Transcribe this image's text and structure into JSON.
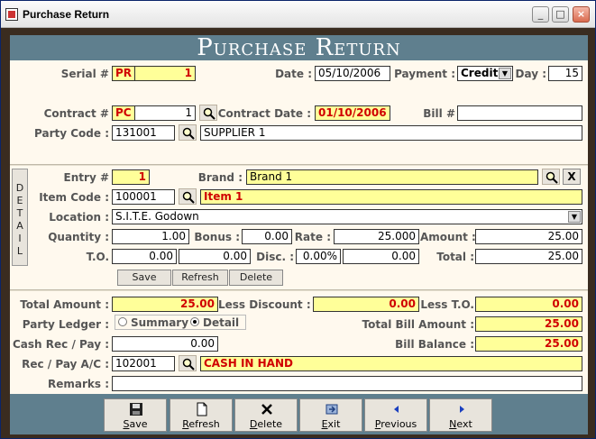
{
  "window": {
    "title": "Purchase Return"
  },
  "header": {
    "title": "Purchase Return"
  },
  "top": {
    "serial_label": "Serial #",
    "serial_prefix": "PR",
    "serial_no": "1",
    "date_label": "Date :",
    "date": "05/10/2006",
    "payment_label": "Payment :",
    "payment": "Credit",
    "day_label": "Day :",
    "day": "15",
    "contract_label": "Contract #",
    "contract_prefix": "PC",
    "contract_no": "1",
    "contract_date_label": "Contract Date :",
    "contract_date": "01/10/2006",
    "bill_label": "Bill #",
    "bill": "",
    "party_code_label": "Party Code :",
    "party_code": "131001",
    "party_name": "SUPPLIER 1"
  },
  "detail": {
    "side_label": [
      "D",
      "E",
      "T",
      "A",
      "I",
      "L"
    ],
    "entry_label": "Entry #",
    "entry": "1",
    "brand_label": "Brand :",
    "brand": "Brand 1",
    "item_code_label": "Item Code :",
    "item_code": "100001",
    "item_name": "Item 1",
    "location_label": "Location :",
    "location": "S.I.T.E. Godown",
    "quantity_label": "Quantity :",
    "quantity": "1.00",
    "bonus_label": "Bonus :",
    "bonus": "0.00",
    "rate_label": "Rate :",
    "rate": "25.000",
    "amount_label": "Amount :",
    "amount": "25.00",
    "to_label": "T.O.",
    "to_pct": "0.00",
    "to_value": "0.00",
    "disc_label": "Disc. :",
    "disc_pct": "0.00%",
    "disc_value": "0.00",
    "total_label": "Total :",
    "total": "25.00",
    "save_label": "Save",
    "refresh_label": "Refresh",
    "delete_label": "Delete"
  },
  "summary": {
    "total_amount_label": "Total Amount :",
    "total_amount": "25.00",
    "less_discount_label": "Less Discount :",
    "less_discount": "0.00",
    "less_to_label": "Less T.O.",
    "less_to": "0.00",
    "party_ledger_label": "Party Ledger :",
    "summary_option": "Summary",
    "detail_option": "Detail",
    "total_bill_label": "Total Bill Amount :",
    "total_bill": "25.00",
    "cash_label": "Cash Rec / Pay :",
    "cash": "0.00",
    "bill_balance_label": "Bill Balance :",
    "bill_balance": "25.00",
    "account_label": "Rec / Pay A/C :",
    "account_code": "102001",
    "account_name": "CASH IN HAND",
    "remarks_label": "Remarks :",
    "remarks": ""
  },
  "footer": {
    "save": "Save",
    "refresh": "Refresh",
    "delete": "Delete",
    "exit": "Exit",
    "previous": "Previous",
    "next": "Next"
  }
}
